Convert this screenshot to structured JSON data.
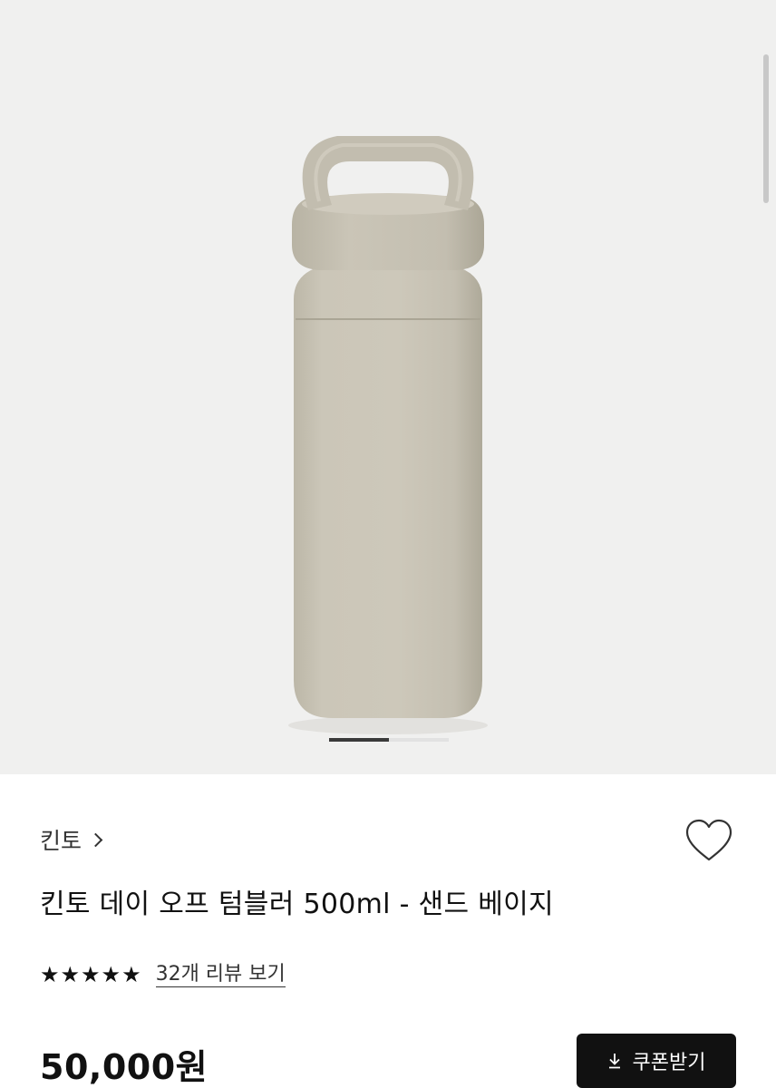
{
  "gallery": {
    "image_alt": "킨토 데이 오프 텀블러 500ml - 샌드 베이지",
    "current_slide": 1,
    "total_slides": 2,
    "pager_progress": 0.5
  },
  "product": {
    "brand": "킨토",
    "title": "킨토 데이 오프 텀블러 500ml - 샌드 베이지",
    "rating_stars": 5,
    "review_link": "32개 리뷰 보기",
    "price": "50,000원",
    "coupon_button": "쿠폰받기"
  },
  "icons": {
    "wishlist": "heart-outline-icon",
    "brand_chevron": "chevron-right-icon",
    "coupon": "download-icon",
    "star": "star-filled-icon"
  },
  "colors": {
    "image_bg": "#f0f0ef",
    "bottle": "#c9c4b6",
    "button_bg": "#111111",
    "text": "#111111"
  }
}
